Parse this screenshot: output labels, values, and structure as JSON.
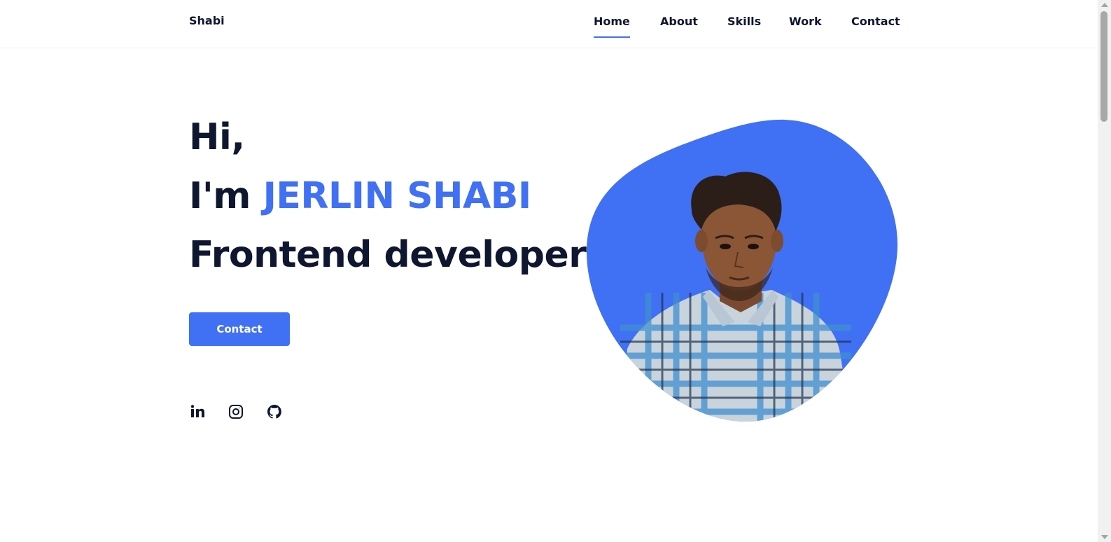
{
  "header": {
    "logo": "Shabi",
    "nav": [
      {
        "label": "Home",
        "active": true
      },
      {
        "label": "About"
      },
      {
        "label": "Skills"
      },
      {
        "label": "Work"
      },
      {
        "label": "Contact"
      }
    ]
  },
  "hero": {
    "greeting": "Hi,",
    "intro_prefix": "I'm",
    "name": "JERLIN SHABI",
    "role": "Frontend developer",
    "cta_label": "Contact"
  },
  "social": [
    {
      "icon": "linkedin-icon"
    },
    {
      "icon": "instagram-icon"
    },
    {
      "icon": "github-icon"
    }
  ],
  "colors": {
    "accent": "#4070f4",
    "text": "#0e1630",
    "background": "#ffffff"
  }
}
